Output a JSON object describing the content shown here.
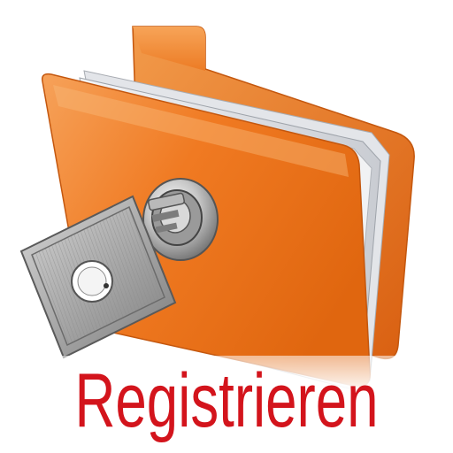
{
  "label": {
    "text": "Registrieren",
    "color": "#d3141c"
  },
  "illustration": {
    "icon": "locked-folder-with-key-icon",
    "folder_color": "#f07a22",
    "key_color": "#a9a9a9"
  }
}
